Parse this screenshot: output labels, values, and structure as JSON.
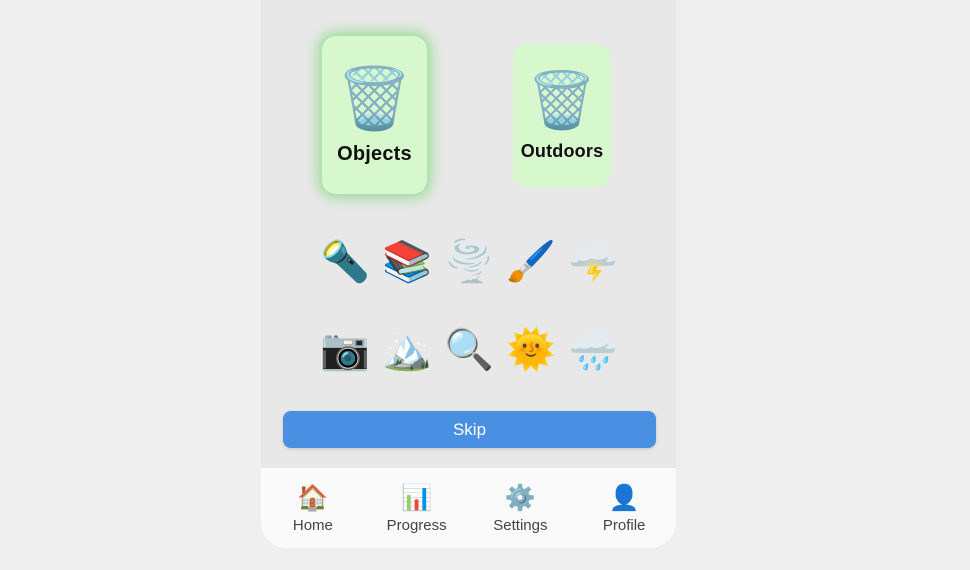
{
  "app": {
    "background_color": "#e8e8e8",
    "page_background_color": "#efefef"
  },
  "categories": {
    "selected_index": 0,
    "card_color": "#d7f7cd",
    "highlight_color": "#78d778",
    "items": [
      {
        "label": "Objects",
        "icon": "wastebasket-icon",
        "glyph": "🗑️",
        "selected": true
      },
      {
        "label": "Outdoors",
        "icon": "wastebasket-icon",
        "glyph": "🗑️",
        "selected": false
      }
    ]
  },
  "emoji_grid": {
    "rows": [
      [
        {
          "name": "flashlight-icon",
          "glyph": "🔦"
        },
        {
          "name": "books-icon",
          "glyph": "📚"
        },
        {
          "name": "tornado-icon",
          "glyph": "🌪️"
        },
        {
          "name": "paintbrush-icon",
          "glyph": "🖌️"
        },
        {
          "name": "cloud-with-lightning-icon",
          "glyph": "🌩️"
        }
      ],
      [
        {
          "name": "camera-icon",
          "glyph": "📷"
        },
        {
          "name": "snow-capped-mountain-icon",
          "glyph": "🏔️"
        },
        {
          "name": "magnifying-glass-icon",
          "glyph": "🔍"
        },
        {
          "name": "sun-with-face-icon",
          "glyph": "🌞"
        },
        {
          "name": "cloud-with-rain-icon",
          "glyph": "🌧️"
        }
      ]
    ]
  },
  "skip_button": {
    "label": "Skip",
    "color": "#4a90e2",
    "text_color": "#ffffff"
  },
  "bottom_nav": {
    "label_color": "#444444",
    "background_color": "#fafafa",
    "items": [
      {
        "label": "Home",
        "icon": "house-icon",
        "glyph": "🏠"
      },
      {
        "label": "Progress",
        "icon": "bar-chart-icon",
        "glyph": "📊"
      },
      {
        "label": "Settings",
        "icon": "gear-icon",
        "glyph": "⚙️"
      },
      {
        "label": "Profile",
        "icon": "user-silhouette-icon",
        "glyph": "👤"
      }
    ]
  }
}
